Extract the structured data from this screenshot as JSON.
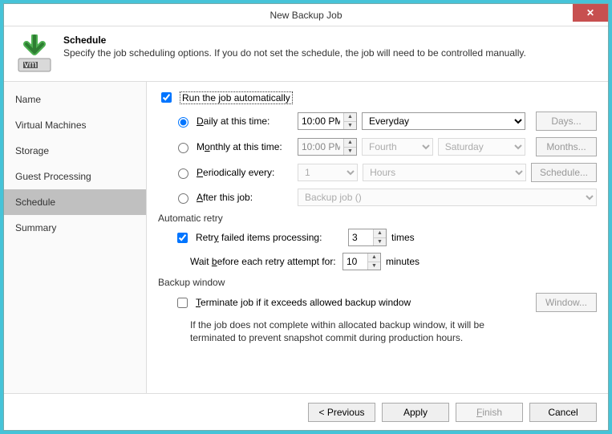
{
  "title": "New Backup Job",
  "header": {
    "title": "Schedule",
    "desc": "Specify the job scheduling options. If you do not set the schedule, the job will need to be controlled manually."
  },
  "sidebar": {
    "items": [
      {
        "label": "Name"
      },
      {
        "label": "Virtual Machines"
      },
      {
        "label": "Storage"
      },
      {
        "label": "Guest Processing"
      },
      {
        "label": "Schedule"
      },
      {
        "label": "Summary"
      }
    ]
  },
  "run_auto": {
    "label": "Run the job automatically"
  },
  "daily": {
    "label": "Daily at this time:",
    "time": "10:00 PM",
    "freq": "Everyday",
    "btn": "Days..."
  },
  "monthly": {
    "label": "Monthly at this time:",
    "time": "10:00 PM",
    "ord": "Fourth",
    "day": "Saturday",
    "btn": "Months..."
  },
  "period": {
    "label": "Periodically every:",
    "val": "1",
    "unit": "Hours",
    "btn": "Schedule..."
  },
  "after": {
    "label": "After this job:",
    "job": "Backup job ()"
  },
  "retry": {
    "group": "Automatic retry",
    "label": "Retry failed items processing:",
    "count": "3",
    "times": "times",
    "wait_label": "Wait before each retry attempt for:",
    "wait_val": "10",
    "minutes": "minutes"
  },
  "window": {
    "group": "Backup window",
    "label": "Terminate job if it exceeds allowed backup window",
    "btn": "Window...",
    "note": "If the job does not complete within allocated backup window, it will be terminated to prevent snapshot commit during production hours."
  },
  "footer": {
    "previous": "< Previous",
    "apply": "Apply",
    "finish": "Finish",
    "cancel": "Cancel"
  }
}
